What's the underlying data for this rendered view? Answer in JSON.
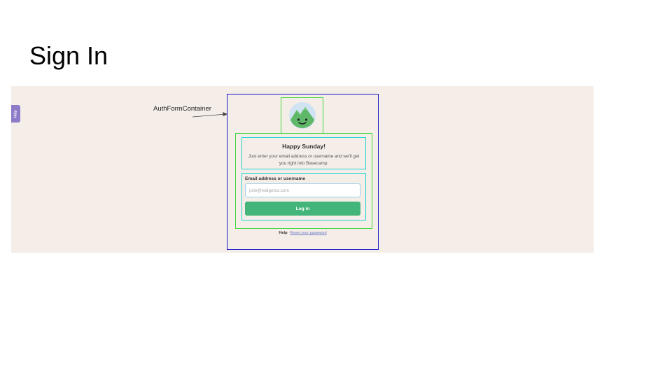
{
  "slide": {
    "title": "Sign In"
  },
  "app": {
    "help_tab_label": "Help",
    "annotation_label": "AuthFormContainer",
    "logo_icon": "basecamp-mountain-logo-icon",
    "greeting": {
      "title": "Happy Sunday!",
      "text": "Just enter your email address or username and we'll get you right into Basecamp."
    },
    "login_form": {
      "email_label": "Email address or username",
      "email_placeholder": "julie@widgetco.com",
      "email_value": "",
      "submit_label": "Log in"
    },
    "footer": {
      "help_label": "Help",
      "reset_link_label": "Reset your password"
    }
  },
  "colors": {
    "page_background": "#f5ede7",
    "primary_button": "#44b57a",
    "help_tab": "#8d7bc8",
    "container_outline": "#1a1acc",
    "section_outline": "#3ed63e",
    "inner_outline": "#1ed6d6"
  }
}
